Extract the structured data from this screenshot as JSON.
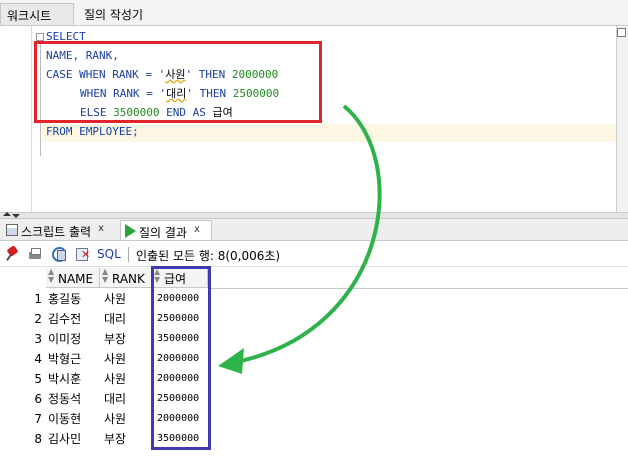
{
  "top_tabs": [
    {
      "label": "워크시트",
      "active": true
    },
    {
      "label": "질의 작성기",
      "active": false
    }
  ],
  "editor": {
    "lines": [
      {
        "text": "SELECT"
      },
      {
        "text": "NAME, RANK,"
      },
      {
        "parts": [
          "CASE WHEN RANK = '",
          "사원",
          "' THEN ",
          "2000000"
        ]
      },
      {
        "parts": [
          "WHEN RANK = '",
          "대리",
          "' THEN ",
          "2500000"
        ]
      },
      {
        "parts": [
          "ELSE ",
          "3500000",
          " END AS ",
          "급여"
        ]
      },
      {
        "text": "FROM EMPLOYEE;"
      }
    ]
  },
  "bottom_tabs": [
    {
      "label": "스크립트 출력",
      "close": "x"
    },
    {
      "label": "질의 결과",
      "close": "x",
      "active": true
    }
  ],
  "toolbar": {
    "sql_label": "SQL",
    "status": "인출된 모든 행: 8(0,006초)"
  },
  "grid": {
    "columns": [
      "NAME",
      "RANK",
      "급여"
    ],
    "rows": [
      {
        "num": "1",
        "name": "홍길동",
        "rank": "사원",
        "pay": "2000000"
      },
      {
        "num": "2",
        "name": "김수전",
        "rank": "대리",
        "pay": "2500000"
      },
      {
        "num": "3",
        "name": "이미정",
        "rank": "부장",
        "pay": "3500000"
      },
      {
        "num": "4",
        "name": "박형근",
        "rank": "사원",
        "pay": "2000000"
      },
      {
        "num": "5",
        "name": "박시훈",
        "rank": "사원",
        "pay": "2000000"
      },
      {
        "num": "6",
        "name": "정동석",
        "rank": "대리",
        "pay": "2500000"
      },
      {
        "num": "7",
        "name": "이동현",
        "rank": "사원",
        "pay": "2000000"
      },
      {
        "num": "8",
        "name": "김사민",
        "rank": "부장",
        "pay": "3500000"
      }
    ]
  },
  "colors": {
    "annotation_red": "#e0262c",
    "annotation_blue": "#3f3ab0",
    "annotation_green": "#2eb34a",
    "sql_keyword": "#1b3ea0",
    "sql_number": "#1f8a1f"
  }
}
